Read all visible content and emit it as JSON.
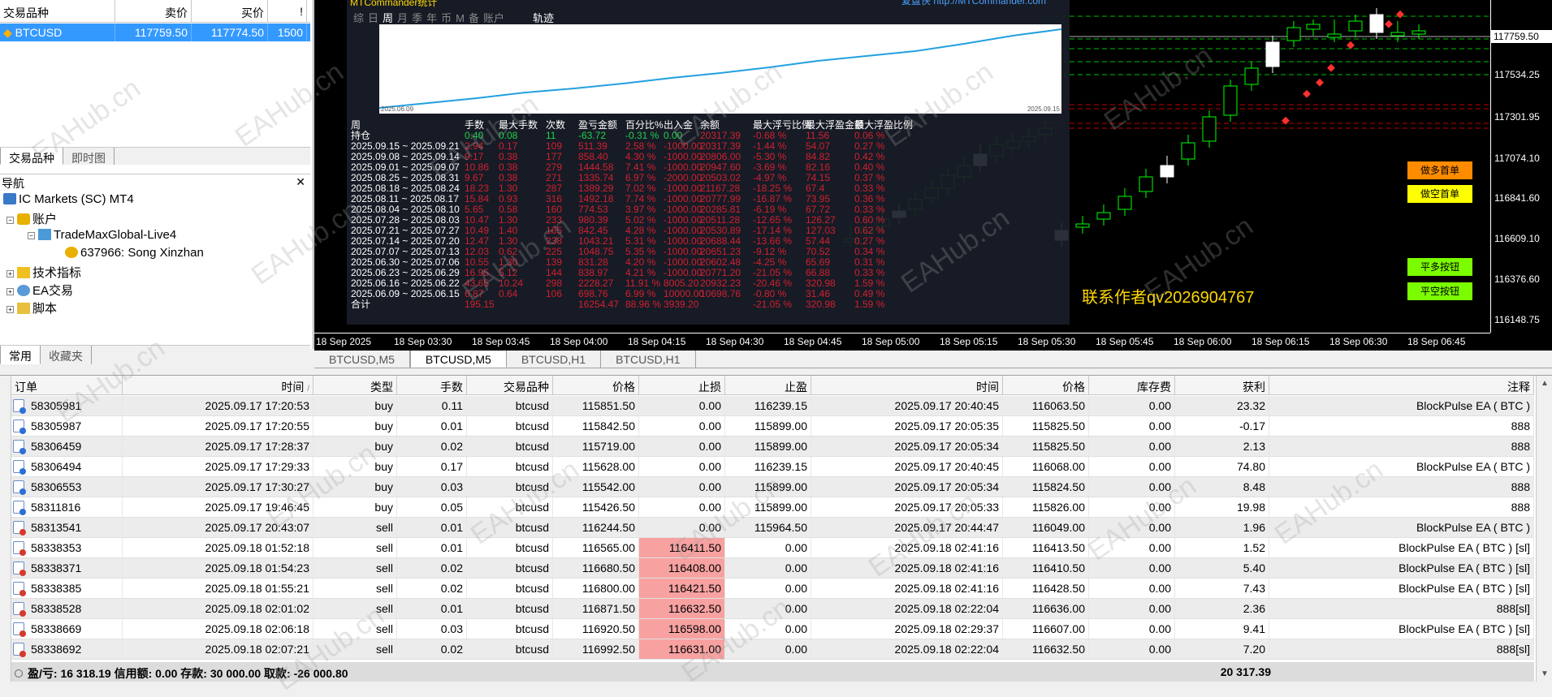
{
  "market_watch": {
    "headers": [
      "交易品种",
      "卖价",
      "买价",
      "!"
    ],
    "row": {
      "symbol": "BTCUSD",
      "bid": "117759.50",
      "ask": "117774.50",
      "spread": "1500"
    },
    "tabs": [
      "交易品种",
      "即时图"
    ]
  },
  "navigator": {
    "title": "导航",
    "broker": "IC Markets (SC) MT4",
    "accounts_label": "账户",
    "server": "TradeMaxGlobal-Live4",
    "account": "637966: Song Xinzhan",
    "indicators": "技术指标",
    "experts": "EA交易",
    "scripts": "脚本",
    "tabs": [
      "常用",
      "收藏夹"
    ]
  },
  "chart": {
    "current_price": "117759.50",
    "price_labels": [
      "117534.25",
      "117301.95",
      "117074.10",
      "116841.60",
      "116609.10",
      "116376.60",
      "116148.75"
    ],
    "time_labels": [
      "18 Sep 2025",
      "18 Sep 03:30",
      "18 Sep 03:45",
      "18 Sep 04:00",
      "18 Sep 04:15",
      "18 Sep 04:30",
      "18 Sep 04:45",
      "18 Sep 05:00",
      "18 Sep 05:15",
      "18 Sep 05:30",
      "18 Sep 05:45",
      "18 Sep 06:00",
      "18 Sep 06:15",
      "18 Sep 06:30",
      "18 Sep 06:45"
    ],
    "top_url": "复盘侠 http://MTCommander.com",
    "buttons": {
      "long_first": "做多首单",
      "short_first": "做空首单",
      "close_long": "平多按钮",
      "close_short": "平空按钮"
    },
    "contact": "联系作者qv2026904767",
    "colors": {
      "long_first": "#ff8c00",
      "short_first": "#ffff00",
      "close_btn": "#7cfc00",
      "bull": "#00ff00"
    }
  },
  "stats": {
    "title": "MTCommander统计",
    "tabs": [
      "综",
      "日",
      "周",
      "月",
      "季",
      "年",
      "币",
      "M",
      "备",
      "账户"
    ],
    "active_tab": "周",
    "track_label": "轨迹",
    "curve_start": "2025.06.09",
    "curve_end": "2025.09.15",
    "headers": [
      "周",
      "手数",
      "最大手数",
      "次数",
      "盈亏金额",
      "百分比%",
      "出入金",
      "余额",
      "最大浮亏比例",
      "最大浮盈金额",
      "最大浮盈比例"
    ],
    "hold_label": "持仓",
    "hold_row": [
      "0.40",
      "0.08",
      "11",
      "-63.72",
      "-0.31 %",
      "0.00",
      "20317.39",
      "-0.68 %",
      "11.56",
      "0.06 %"
    ],
    "rows": [
      [
        "2025.09.15 ~ 2025.09.21",
        "2.94",
        "0.17",
        "109",
        "511.39",
        "2.58 %",
        "-1000.00",
        "20317.39",
        "-1.44 %",
        "54.07",
        "0.27 %"
      ],
      [
        "2025.09.08 ~ 2025.09.14",
        "9.17",
        "0.38",
        "177",
        "858.40",
        "4.30 %",
        "-1000.00",
        "20806.00",
        "-5.30 %",
        "84.82",
        "0.42 %"
      ],
      [
        "2025.09.01 ~ 2025.09.07",
        "10.86",
        "0.38",
        "279",
        "1444.58",
        "7.41 %",
        "-1000.00",
        "20947.60",
        "-3.69 %",
        "82.16",
        "0.40 %"
      ],
      [
        "2025.08.25 ~ 2025.08.31",
        "9.67",
        "0.38",
        "271",
        "1335.74",
        "6.97 %",
        "-2000.00",
        "20503.02",
        "-4.97 %",
        "74.15",
        "0.37 %"
      ],
      [
        "2025.08.18 ~ 2025.08.24",
        "18.23",
        "1.30",
        "287",
        "1389.29",
        "7.02 %",
        "-1000.00",
        "21167.28",
        "-18.25 %",
        "67.4",
        "0.33 %"
      ],
      [
        "2025.08.11 ~ 2025.08.17",
        "15.84",
        "0.93",
        "316",
        "1492.18",
        "7.74 %",
        "-1000.00",
        "20777.99",
        "-16.87 %",
        "73.95",
        "0.36 %"
      ],
      [
        "2025.08.04 ~ 2025.08.10",
        "5.65",
        "0.58",
        "160",
        "774.53",
        "3.97 %",
        "-1000.00",
        "20285.81",
        "-6.19 %",
        "67.72",
        "0.33 %"
      ],
      [
        "2025.07.28 ~ 2025.08.03",
        "10.47",
        "1.30",
        "233",
        "980.39",
        "5.02 %",
        "-1000.00",
        "20511.28",
        "-12.65 %",
        "126.27",
        "0.60 %"
      ],
      [
        "2025.07.21 ~ 2025.07.27",
        "10.49",
        "1.40",
        "165",
        "842.45",
        "4.28 %",
        "-1000.00",
        "20530.89",
        "-17.14 %",
        "127.03",
        "0.62 %"
      ],
      [
        "2025.07.14 ~ 2025.07.20",
        "12.47",
        "1.30",
        "238",
        "1043.21",
        "5.31 %",
        "-1000.00",
        "20688.44",
        "-13.66 %",
        "57.44",
        "0.27 %"
      ],
      [
        "2025.07.07 ~ 2025.07.13",
        "12.03",
        "0.62",
        "225",
        "1048.75",
        "5.35 %",
        "-1000.00",
        "20651.23",
        "-9.12 %",
        "70.52",
        "0.34 %"
      ],
      [
        "2025.06.30 ~ 2025.07.06",
        "10.55",
        "1.30",
        "139",
        "831.28",
        "4.20 %",
        "-1000.00",
        "20602.48",
        "-4.25 %",
        "65.69",
        "0.31 %"
      ],
      [
        "2025.06.23 ~ 2025.06.29",
        "16.95",
        "5.12",
        "144",
        "838.97",
        "4.21 %",
        "-1000.00",
        "20771.20",
        "-21.05 %",
        "66.88",
        "0.33 %"
      ],
      [
        "2025.06.16 ~ 2025.06.22",
        "43.65",
        "10.24",
        "298",
        "2228.27",
        "11.91 %",
        "8005.20",
        "20932.23",
        "-20.46 %",
        "320.98",
        "1.59 %"
      ],
      [
        "2025.06.09 ~ 2025.06.15",
        "6.87",
        "0.64",
        "106",
        "698.76",
        "6.99 %",
        "10000.00",
        "10698.76",
        "-0.80 %",
        "31.46",
        "0.49 %"
      ]
    ],
    "total_label": "合计",
    "total_row": [
      "195.15",
      "",
      "",
      "16254.47",
      "88.96 %",
      "3939.20",
      "",
      "-21.05 %",
      "320.98",
      "1.59 %"
    ]
  },
  "chart_tabs": [
    "BTCUSD,M5",
    "BTCUSD,M5",
    "BTCUSD,H1",
    "BTCUSD,H1"
  ],
  "terminal": {
    "headers": [
      "订单",
      "时间",
      "类型",
      "手数",
      "交易品种",
      "价格",
      "止损",
      "止盈",
      "时间",
      "价格",
      "库存费",
      "获利",
      "注释"
    ],
    "rows": [
      {
        "order": "58305981",
        "time": "2025.09.17 17:20:53",
        "type": "buy",
        "lots": "0.11",
        "symbol": "btcusd",
        "price": "115851.50",
        "sl": "0.00",
        "tp": "116239.15",
        "ctime": "2025.09.17 20:40:45",
        "cprice": "116063.50",
        "swap": "0.00",
        "profit": "23.32",
        "comment": "BlockPulse EA ( BTC )"
      },
      {
        "order": "58305987",
        "time": "2025.09.17 17:20:55",
        "type": "buy",
        "lots": "0.01",
        "symbol": "btcusd",
        "price": "115842.50",
        "sl": "0.00",
        "tp": "115899.00",
        "ctime": "2025.09.17 20:05:35",
        "cprice": "115825.50",
        "swap": "0.00",
        "profit": "-0.17",
        "comment": "888"
      },
      {
        "order": "58306459",
        "time": "2025.09.17 17:28:37",
        "type": "buy",
        "lots": "0.02",
        "symbol": "btcusd",
        "price": "115719.00",
        "sl": "0.00",
        "tp": "115899.00",
        "ctime": "2025.09.17 20:05:34",
        "cprice": "115825.50",
        "swap": "0.00",
        "profit": "2.13",
        "comment": "888"
      },
      {
        "order": "58306494",
        "time": "2025.09.17 17:29:33",
        "type": "buy",
        "lots": "0.17",
        "symbol": "btcusd",
        "price": "115628.00",
        "sl": "0.00",
        "tp": "116239.15",
        "ctime": "2025.09.17 20:40:45",
        "cprice": "116068.00",
        "swap": "0.00",
        "profit": "74.80",
        "comment": "BlockPulse EA ( BTC )"
      },
      {
        "order": "58306553",
        "time": "2025.09.17 17:30:27",
        "type": "buy",
        "lots": "0.03",
        "symbol": "btcusd",
        "price": "115542.00",
        "sl": "0.00",
        "tp": "115899.00",
        "ctime": "2025.09.17 20:05:34",
        "cprice": "115824.50",
        "swap": "0.00",
        "profit": "8.48",
        "comment": "888"
      },
      {
        "order": "58311816",
        "time": "2025.09.17 19:46:45",
        "type": "buy",
        "lots": "0.05",
        "symbol": "btcusd",
        "price": "115426.50",
        "sl": "0.00",
        "tp": "115899.00",
        "ctime": "2025.09.17 20:05:33",
        "cprice": "115826.00",
        "swap": "0.00",
        "profit": "19.98",
        "comment": "888"
      },
      {
        "order": "58313541",
        "time": "2025.09.17 20:43:07",
        "type": "sell",
        "lots": "0.01",
        "symbol": "btcusd",
        "price": "116244.50",
        "sl": "0.00",
        "tp": "115964.50",
        "ctime": "2025.09.17 20:44:47",
        "cprice": "116049.00",
        "swap": "0.00",
        "profit": "1.96",
        "comment": "BlockPulse EA ( BTC )"
      },
      {
        "order": "58338353",
        "time": "2025.09.18 01:52:18",
        "type": "sell",
        "lots": "0.01",
        "symbol": "btcusd",
        "price": "116565.00",
        "sl": "116411.50",
        "tp": "0.00",
        "ctime": "2025.09.18 02:41:16",
        "cprice": "116413.50",
        "swap": "0.00",
        "profit": "1.52",
        "comment": "BlockPulse EA ( BTC ) [sl]"
      },
      {
        "order": "58338371",
        "time": "2025.09.18 01:54:23",
        "type": "sell",
        "lots": "0.02",
        "symbol": "btcusd",
        "price": "116680.50",
        "sl": "116408.00",
        "tp": "0.00",
        "ctime": "2025.09.18 02:41:16",
        "cprice": "116410.50",
        "swap": "0.00",
        "profit": "5.40",
        "comment": "BlockPulse EA ( BTC ) [sl]"
      },
      {
        "order": "58338385",
        "time": "2025.09.18 01:55:21",
        "type": "sell",
        "lots": "0.02",
        "symbol": "btcusd",
        "price": "116800.00",
        "sl": "116421.50",
        "tp": "0.00",
        "ctime": "2025.09.18 02:41:16",
        "cprice": "116428.50",
        "swap": "0.00",
        "profit": "7.43",
        "comment": "BlockPulse EA ( BTC ) [sl]"
      },
      {
        "order": "58338528",
        "time": "2025.09.18 02:01:02",
        "type": "sell",
        "lots": "0.01",
        "symbol": "btcusd",
        "price": "116871.50",
        "sl": "116632.50",
        "tp": "0.00",
        "ctime": "2025.09.18 02:22:04",
        "cprice": "116636.00",
        "swap": "0.00",
        "profit": "2.36",
        "comment": "888[sl]"
      },
      {
        "order": "58338669",
        "time": "2025.09.18 02:06:18",
        "type": "sell",
        "lots": "0.03",
        "symbol": "btcusd",
        "price": "116920.50",
        "sl": "116598.00",
        "tp": "0.00",
        "ctime": "2025.09.18 02:29:37",
        "cprice": "116607.00",
        "swap": "0.00",
        "profit": "9.41",
        "comment": "BlockPulse EA ( BTC ) [sl]"
      },
      {
        "order": "58338692",
        "time": "2025.09.18 02:07:21",
        "type": "sell",
        "lots": "0.02",
        "symbol": "btcusd",
        "price": "116992.50",
        "sl": "116631.00",
        "tp": "0.00",
        "ctime": "2025.09.18 02:22:04",
        "cprice": "116632.50",
        "swap": "0.00",
        "profit": "7.20",
        "comment": "888[sl]"
      }
    ],
    "footer": {
      "summary": "盈/亏: 16 318.19  信用额: 0.00  存款: 30 000.00  取款: -26 000.80",
      "total_profit": "20 317.39"
    }
  },
  "watermark": "EAHub.cn"
}
